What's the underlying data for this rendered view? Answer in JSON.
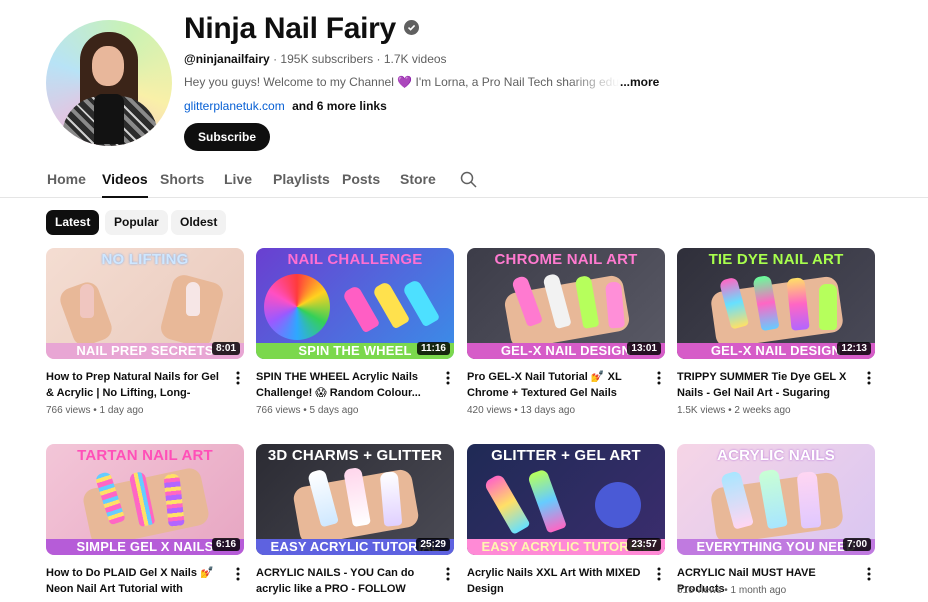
{
  "channel": {
    "name": "Ninja Nail Fairy",
    "handle": "@ninjanailfairy",
    "subscribers": "195K subscribers",
    "separator": "·",
    "video_count": "1.7K videos",
    "description": "Hey you guys! Welcome to my Channel 💜 I'm Lorna, a Pro Nail Tech sharing education a",
    "more_label": "...more",
    "link": "glitterplanetuk.com",
    "more_links": "and 6 more links",
    "subscribe_label": "Subscribe"
  },
  "tabs": [
    "Home",
    "Videos",
    "Shorts",
    "Live",
    "Playlists",
    "Posts",
    "Store"
  ],
  "active_tab": "Videos",
  "chips": [
    "Latest",
    "Popular",
    "Oldest"
  ],
  "active_chip": "Latest",
  "colors": {
    "accent": "#0f0f0f",
    "link": "#065fd4",
    "secondary_text": "#606060"
  },
  "icons": {
    "verified": "check-circle-icon",
    "search": "search-icon",
    "menu": "more-vertical-icon"
  },
  "videos": [
    {
      "thumb_top": "NO LIFTING",
      "thumb_bottom": "NAIL PREP SECRETS",
      "duration": "8:01",
      "title": "How to Prep Natural Nails for Gel & Acrylic | No Lifting, Long-Lasting...",
      "views": "766 views",
      "age": "1 day ago"
    },
    {
      "thumb_top": "NAIL CHALLENGE",
      "thumb_bottom": "SPIN THE WHEEL",
      "duration": "11:16",
      "title": "SPIN THE WHEEL Acrylic Nails Challenge! 😱 Random Colour...",
      "views": "766 views",
      "age": "5 days ago"
    },
    {
      "thumb_top": "CHROME NAIL ART",
      "thumb_bottom": "GEL-X NAIL DESIGN",
      "duration": "13:01",
      "title": "Pro GEL-X Nail Tutorial 💅 XL Chrome + Textured Gel Nails Usin...",
      "views": "420 views",
      "age": "13 days ago"
    },
    {
      "thumb_top": "TIE DYE NAIL ART",
      "thumb_bottom": "GEL-X NAIL DESIGN",
      "duration": "12:13",
      "title": "TRIPPY SUMMER Tie Dye GEL X Nails - Gel Nail Art - Sugaring Nails",
      "views": "1.5K views",
      "age": "2 weeks ago"
    },
    {
      "thumb_top": "TARTAN NAIL ART",
      "thumb_bottom": "SIMPLE GEL X NAILS",
      "duration": "6:16",
      "title": "How to Do PLAID Gel X Nails 💅 Neon Nail Art Tutorial with Glass...",
      "views": "",
      "age": ""
    },
    {
      "thumb_top": "3D CHARMS + GLITTER",
      "thumb_bottom": "EASY ACRYLIC TUTORIAL",
      "duration": "25:29",
      "title": "ACRYLIC NAILS - YOU Can do acrylic like a PRO - FOLLOW This...",
      "views": "",
      "age": ""
    },
    {
      "thumb_top": "GLITTER + GEL ART",
      "thumb_bottom": "EASY ACRYLIC TUTORIAL",
      "duration": "23:57",
      "title": "Acrylic Nails XXL Art With MIXED Design",
      "views": "",
      "age": ""
    },
    {
      "thumb_top": "ACRYLIC NAILS",
      "thumb_bottom": "EVERYTHING YOU NEED",
      "duration": "7:00",
      "title": "ACRYLIC Nail MUST HAVE Products",
      "views": "616 views",
      "age": "1 month ago"
    }
  ]
}
